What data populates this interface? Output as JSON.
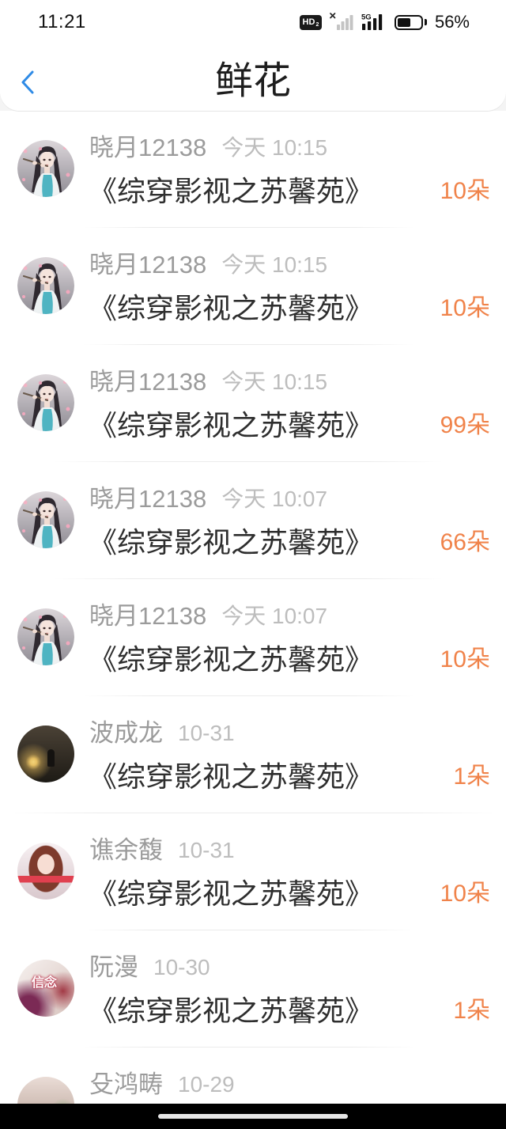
{
  "status_bar": {
    "time": "11:21",
    "hd_label": "HD",
    "hd_sub": "2",
    "network_label": "5G",
    "battery_text": "56%",
    "battery_level": 0.56,
    "icons": [
      "hd-voice-icon",
      "sim1-no-service-signal-icon",
      "signal-5g-icon",
      "battery-icon"
    ]
  },
  "header": {
    "title": "鲜花",
    "back_icon": "chevron-left-icon"
  },
  "colors": {
    "accent_blue": "#2f8be6",
    "count_orange": "#f0834a",
    "name_gray": "#9b9b9b",
    "time_gray": "#bdbdbd",
    "title_dark": "#2e2e2e"
  },
  "list": [
    {
      "name": "晓月12138",
      "time": "今天 10:15",
      "book": "《综穿影视之苏馨苑》",
      "count": "10朵",
      "avatar_icon": "anime-girl-avatar"
    },
    {
      "name": "晓月12138",
      "time": "今天 10:15",
      "book": "《综穿影视之苏馨苑》",
      "count": "10朵",
      "avatar_icon": "anime-girl-avatar"
    },
    {
      "name": "晓月12138",
      "time": "今天 10:15",
      "book": "《综穿影视之苏馨苑》",
      "count": "99朵",
      "avatar_icon": "anime-girl-avatar"
    },
    {
      "name": "晓月12138",
      "time": "今天 10:07",
      "book": "《综穿影视之苏馨苑》",
      "count": "66朵",
      "avatar_icon": "anime-girl-avatar"
    },
    {
      "name": "晓月12138",
      "time": "今天 10:07",
      "book": "《综穿影视之苏馨苑》",
      "count": "10朵",
      "avatar_icon": "anime-girl-avatar"
    },
    {
      "name": "波成龙",
      "time": "10-31",
      "book": "《综穿影视之苏馨苑》",
      "count": "1朵",
      "avatar_icon": "night-photo-avatar"
    },
    {
      "name": "谯余馥",
      "time": "10-31",
      "book": "《综穿影视之苏馨苑》",
      "count": "10朵",
      "avatar_icon": "pink-girl-avatar"
    },
    {
      "name": "阮漫",
      "time": "10-30",
      "book": "《综穿影视之苏馨苑》",
      "count": "1朵",
      "avatar_icon": "xinnian-avatar",
      "avatar_text": "信念"
    },
    {
      "name": "殳鸿畴",
      "time": "10-29",
      "avatar_icon": "pale-photo-avatar"
    }
  ]
}
